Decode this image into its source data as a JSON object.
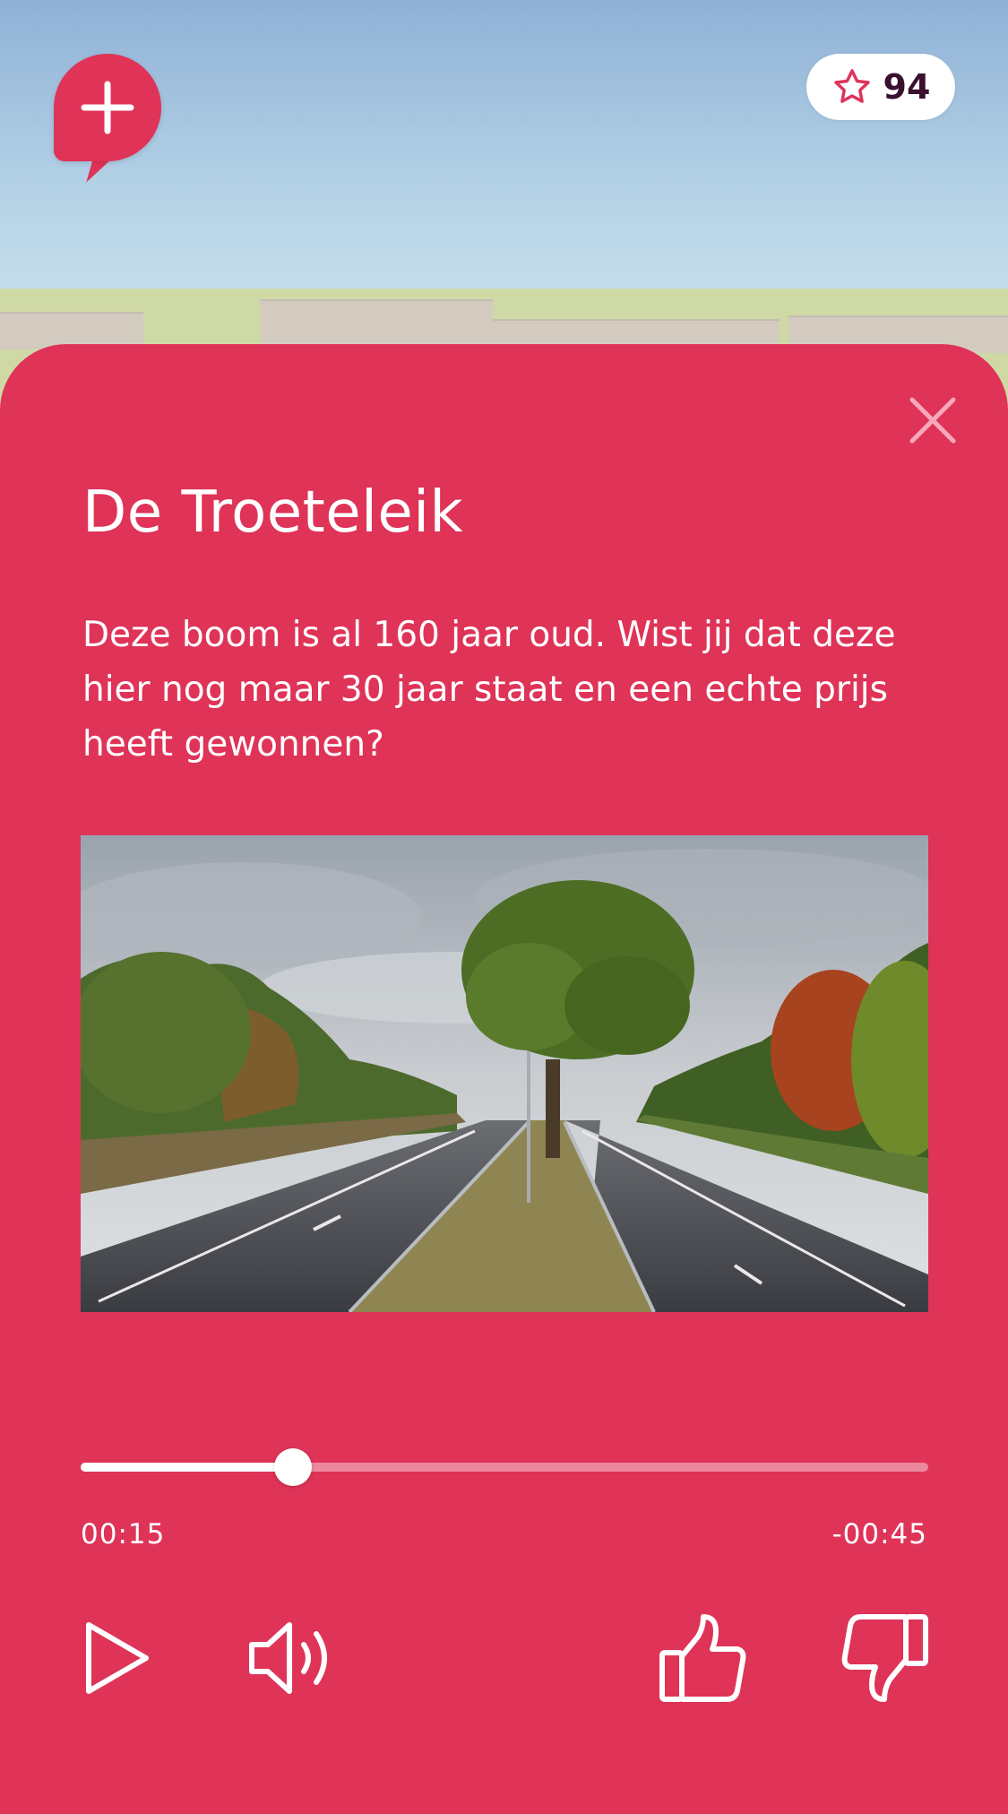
{
  "header": {
    "add_button_icon": "plus-icon",
    "score": {
      "icon": "star-icon",
      "value": "94"
    }
  },
  "card": {
    "title": "De Troeteleik",
    "description": "Deze boom is al 160 jaar oud. Wist jij dat deze hier nog maar 30 jaar staat en een echte prijs heeft gewonnen?",
    "close_icon": "close-icon",
    "image_subject": "oak-tree-in-highway-median-photo"
  },
  "player": {
    "progress": 0.25,
    "elapsed": "00:15",
    "remaining": "-00:45",
    "controls": {
      "play_icon": "play-icon",
      "volume_icon": "volume-icon",
      "like_icon": "thumbs-up-icon",
      "dislike_icon": "thumbs-down-icon"
    }
  },
  "colors": {
    "accent": "#df3358",
    "text_on_accent": "#ffffff",
    "score_text": "#3a1030"
  }
}
